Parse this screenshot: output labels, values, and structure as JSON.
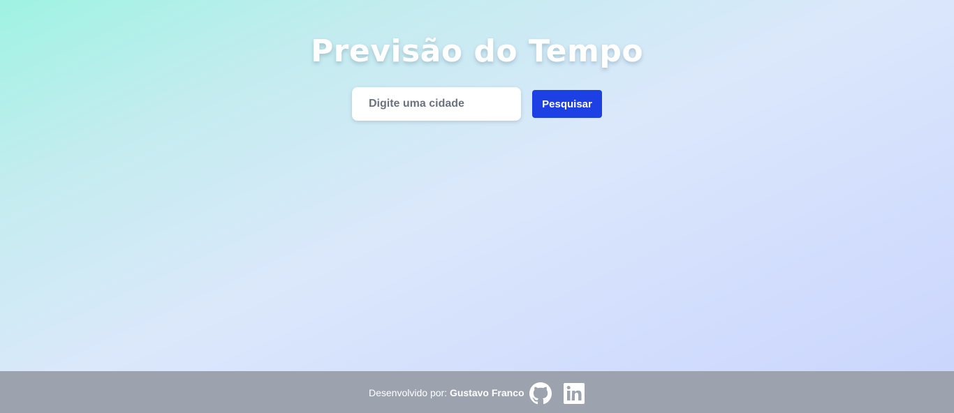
{
  "header": {
    "title": "Previsão do Tempo"
  },
  "search": {
    "placeholder": "Digite uma cidade",
    "value": "",
    "button_label": "Pesquisar"
  },
  "footer": {
    "credit_prefix": "Desenvolvido por:",
    "author": "Gustavo Franco",
    "links": [
      {
        "icon": "github-icon"
      },
      {
        "icon": "linkedin-icon"
      }
    ]
  },
  "colors": {
    "gradient_start": "#9ff3e3",
    "gradient_end": "#c9d4fd",
    "button": "#1d40e4",
    "footer_bg": "#9ca3af",
    "title_text": "#ffffff"
  }
}
